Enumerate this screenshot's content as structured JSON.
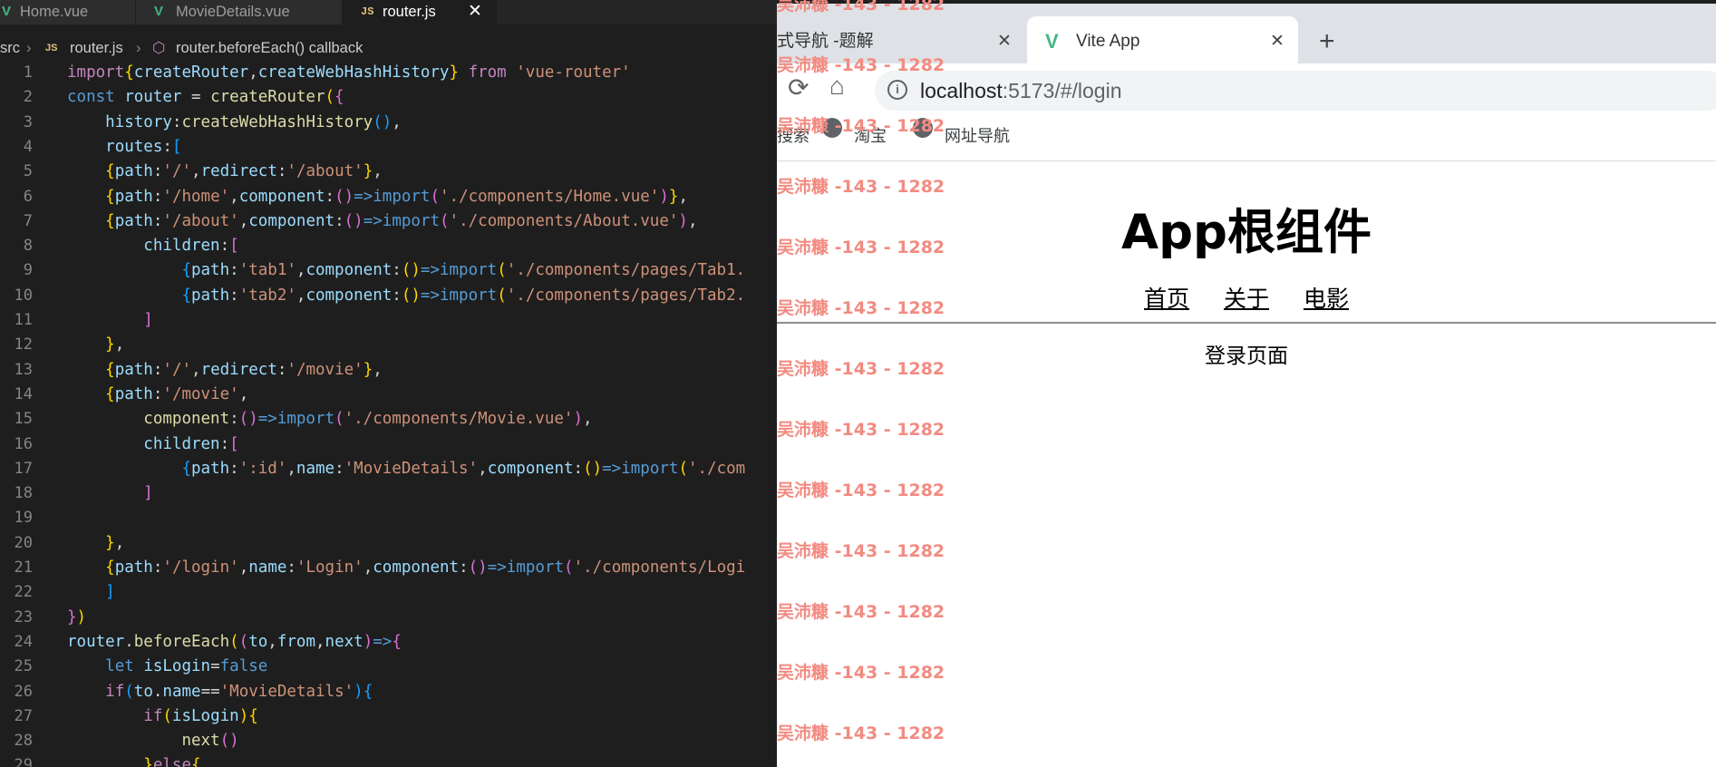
{
  "editor": {
    "tabs": [
      {
        "label": "Home.vue",
        "icon": "vue-icon"
      },
      {
        "label": "MovieDetails.vue",
        "icon": "vue-icon"
      },
      {
        "label": "router.js",
        "icon": "js-icon",
        "active": true
      }
    ],
    "tab_icons": {
      "vue": "V",
      "js": "JS"
    },
    "close": "✕",
    "breadcrumb": {
      "folder": "src",
      "file": "router.js",
      "symbol": "router.beforeEach() callback"
    },
    "line_numbers": [
      "1",
      "2",
      "3",
      "4",
      "5",
      "6",
      "7",
      "8",
      "9",
      "10",
      "11",
      "12",
      "13",
      "14",
      "15",
      "16",
      "17",
      "18",
      "19",
      "20",
      "21",
      "22",
      "23",
      "24",
      "25",
      "26",
      "27",
      "28",
      "29"
    ],
    "code": {
      "import": "import",
      "from": "from",
      "vue_router": "'vue-router'",
      "createRouter": "createRouter",
      "createWebHashHistory": "createWebHashHistory",
      "const": "const",
      "router": "router",
      "history": "history",
      "routes": "routes",
      "path": "path",
      "redirect": "redirect",
      "component": "component",
      "children": "children",
      "name": "name",
      "root": "'/'",
      "about_str": "'/about'",
      "home_str": "'/home'",
      "home_vue": "'./components/Home.vue'",
      "about_vue": "'./components/About.vue'",
      "tab1": "'tab1'",
      "tab1_vue": "'./components/pages/Tab1.",
      "tab2": "'tab2'",
      "tab2_vue": "'./components/pages/Tab2.",
      "movie_str": "'/movie'",
      "movie_vue": "'./components/Movie.vue'",
      "id_str": "':id'",
      "moviedetails": "'MovieDetails'",
      "com_trunc": "'./com",
      "login_str": "'/login'",
      "login_name": "'Login'",
      "logi_trunc": "'./components/Logi",
      "beforeEach": "beforeEach",
      "to": "to",
      "from_v": "from",
      "next": "next",
      "let": "let",
      "isLogin": "isLogin",
      "false": "false",
      "if": "if",
      "else": "else"
    }
  },
  "browser": {
    "tabs": [
      {
        "label": "式导航 -题解"
      },
      {
        "label": "Vite App",
        "active": true
      }
    ],
    "close": "✕",
    "new_tab": "+",
    "url_host": "localhost",
    "url_rest": ":5173/#/login",
    "bookmarks": [
      "搜索",
      "淘宝",
      "网址导航"
    ],
    "page": {
      "title": "App根组件",
      "nav": [
        "首页",
        "关于",
        "电影"
      ],
      "content": "登录页面"
    },
    "watermark": "吴沛糠 -143 - 1282"
  },
  "colors": {
    "keyword": "#c586c0",
    "decl": "#569cd6",
    "string": "#ce9178",
    "variable": "#9cdcfe",
    "function": "#dcdcaa",
    "vue_green": "#41b883",
    "watermark": "#f28b82"
  }
}
